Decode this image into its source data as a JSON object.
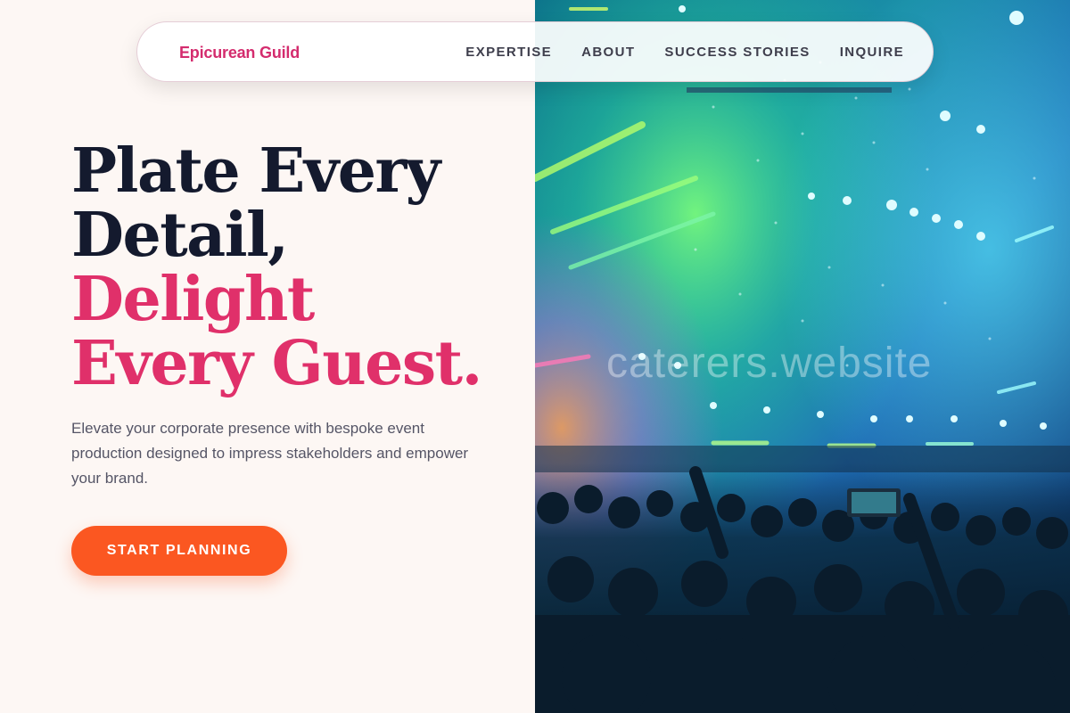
{
  "nav": {
    "brand": "Epicurean Guild",
    "links": [
      "EXPERTISE",
      "ABOUT",
      "SUCCESS STORIES",
      "INQUIRE"
    ]
  },
  "hero": {
    "headline_line1": "Plate Every",
    "headline_line2": "Detail,",
    "headline_line3": "Delight",
    "headline_line4": "Every Guest.",
    "subtext": "Elevate your corporate presence with bespoke event production designed to impress stakeholders and empower your brand.",
    "cta_label": "START PLANNING"
  },
  "image": {
    "description_icon": "concert-crowd-image",
    "watermark": "caterers.website"
  },
  "colors": {
    "brand": "#d42c6e",
    "headline_dark": "#141a2e",
    "headline_accent": "#e0306a",
    "cta": "#fb5721",
    "background": "#fdf7f4"
  }
}
